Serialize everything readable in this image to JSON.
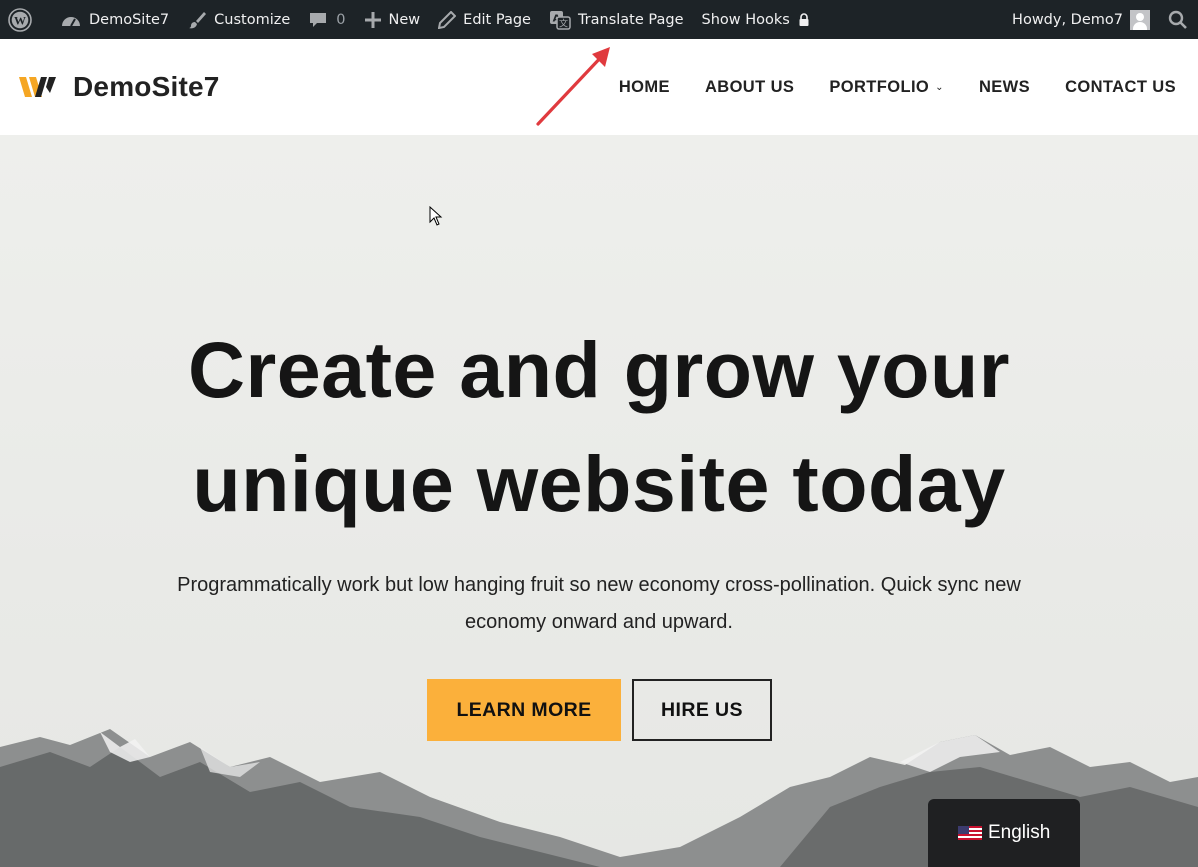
{
  "adminbar": {
    "site_name": "DemoSite7",
    "customize": "Customize",
    "comments_count": "0",
    "new": "New",
    "edit_page": "Edit Page",
    "translate_page": "Translate Page",
    "show_hooks": "Show Hooks",
    "howdy": "Howdy, Demo7"
  },
  "header": {
    "brand": "DemoSite7",
    "nav": [
      "HOME",
      "ABOUT US",
      "PORTFOLIO",
      "NEWS",
      "CONTACT US"
    ]
  },
  "hero": {
    "title_line1": "Create and grow your",
    "title_line2": "unique website today",
    "subtitle": "Programmatically work but low hanging fruit so new economy cross-pollination. Quick sync new economy onward and upward.",
    "primary_button": "LEARN MORE",
    "secondary_button": "HIRE US"
  },
  "language_switcher": {
    "label": "English"
  },
  "colors": {
    "adminbar_bg": "#1d2327",
    "accent": "#fbb03b",
    "annotation_arrow": "#e03a3e"
  }
}
